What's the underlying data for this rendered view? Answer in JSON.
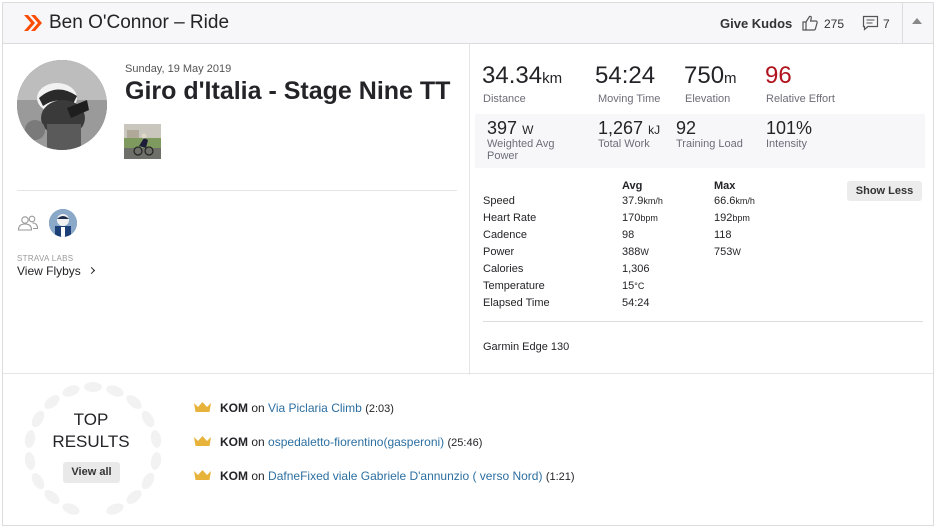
{
  "header": {
    "title": "Ben O'Connor – Ride",
    "give_kudos": "Give Kudos",
    "kudos_count": "275",
    "comment_count": "7"
  },
  "activity": {
    "date": "Sunday, 19 May 2019",
    "name": "Giro d'Italia - Stage Nine TT"
  },
  "flybys": {
    "labs_label": "STRAVA LABS",
    "view_label": "View Flybys"
  },
  "stats": {
    "distance": {
      "value": "34.34",
      "unit": "km",
      "label": "Distance"
    },
    "moving_time": {
      "value": "54:24",
      "label": "Moving Time"
    },
    "elevation": {
      "value": "750",
      "unit": "m",
      "label": "Elevation"
    },
    "relative_effort": {
      "value": "96",
      "label": "Relative Effort"
    }
  },
  "secondary_stats": {
    "weighted_power": {
      "value": "397",
      "unit": "W",
      "label_line1": "Weighted Avg",
      "label_line2": "Power"
    },
    "total_work": {
      "value": "1,267",
      "unit": "kJ",
      "label": "Total Work"
    },
    "training_load": {
      "value": "92",
      "label": "Training Load"
    },
    "intensity": {
      "value": "101%",
      "label": "Intensity"
    }
  },
  "details": {
    "avg_header": "Avg",
    "max_header": "Max",
    "show_less": "Show Less",
    "rows": [
      {
        "label": "Speed",
        "avg": "37.9",
        "avg_unit": "km/h",
        "max": "66.6",
        "max_unit": "km/h"
      },
      {
        "label": "Heart Rate",
        "avg": "170",
        "avg_unit": "bpm",
        "max": "192",
        "max_unit": "bpm"
      },
      {
        "label": "Cadence",
        "avg": "98",
        "avg_unit": "",
        "max": "118",
        "max_unit": ""
      },
      {
        "label": "Power",
        "avg": "388",
        "avg_unit": "W",
        "max": "753",
        "max_unit": "W"
      },
      {
        "label": "Calories",
        "avg": "1,306",
        "avg_unit": "",
        "max": "",
        "max_unit": ""
      },
      {
        "label": "Temperature",
        "avg": "15",
        "avg_unit": "°C",
        "max": "",
        "max_unit": ""
      },
      {
        "label": "Elapsed Time",
        "avg": "54:24",
        "avg_unit": "",
        "max": "",
        "max_unit": ""
      }
    ],
    "device": "Garmin Edge 130"
  },
  "top_results": {
    "title_line1": "TOP",
    "title_line2": "RESULTS",
    "view_all": "View all",
    "items": [
      {
        "award": "KOM",
        "on": "on",
        "segment": "Via Piclaria Climb",
        "time": "(2:03)"
      },
      {
        "award": "KOM",
        "on": "on",
        "segment": "ospedaletto-fiorentino(gasperoni)",
        "time": "(25:46)"
      },
      {
        "award": "KOM",
        "on": "on",
        "segment": "DafneFixed viale Gabriele D'annunzio ( verso Nord)",
        "time": "(1:21)"
      }
    ]
  },
  "colors": {
    "brand": "#fc4c02",
    "relative_effort": "#b0131e",
    "link": "#2c6fa0",
    "crown": "#e8b33b"
  },
  "icons": {
    "logo": "strava-chevron-icon",
    "kudos": "thumbs-up-icon",
    "comments": "comment-icon",
    "collapse": "caret-up-icon",
    "group": "group-icon",
    "award": "crown-icon",
    "wreath": "laurel-wreath-icon"
  }
}
